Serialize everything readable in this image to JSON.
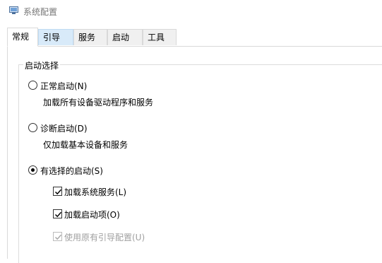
{
  "window": {
    "title": "系统配置",
    "icon": "system-config-icon"
  },
  "tabs": [
    {
      "label": "常规",
      "selected": true
    },
    {
      "label": "引导",
      "selected": false
    },
    {
      "label": "服务",
      "selected": false
    },
    {
      "label": "启动",
      "selected": false
    },
    {
      "label": "工具",
      "selected": false
    }
  ],
  "startup_selection": {
    "group_label": "启动选择",
    "normal": {
      "label": "正常启动(N)",
      "description": "加载所有设备驱动程序和服务",
      "selected": false
    },
    "diagnostic": {
      "label": "诊断启动(D)",
      "description": "仅加载基本设备和服务",
      "selected": false
    },
    "selective": {
      "label": "有选择的启动(S)",
      "selected": true,
      "options": {
        "load_system_services": {
          "label": "加载系统服务(L)",
          "checked": true,
          "enabled": true
        },
        "load_startup_items": {
          "label": "加载启动项(O)",
          "checked": true,
          "enabled": true
        },
        "use_original_boot_config": {
          "label": "使用原有引导配置(U)",
          "checked": true,
          "enabled": false
        }
      }
    }
  }
}
